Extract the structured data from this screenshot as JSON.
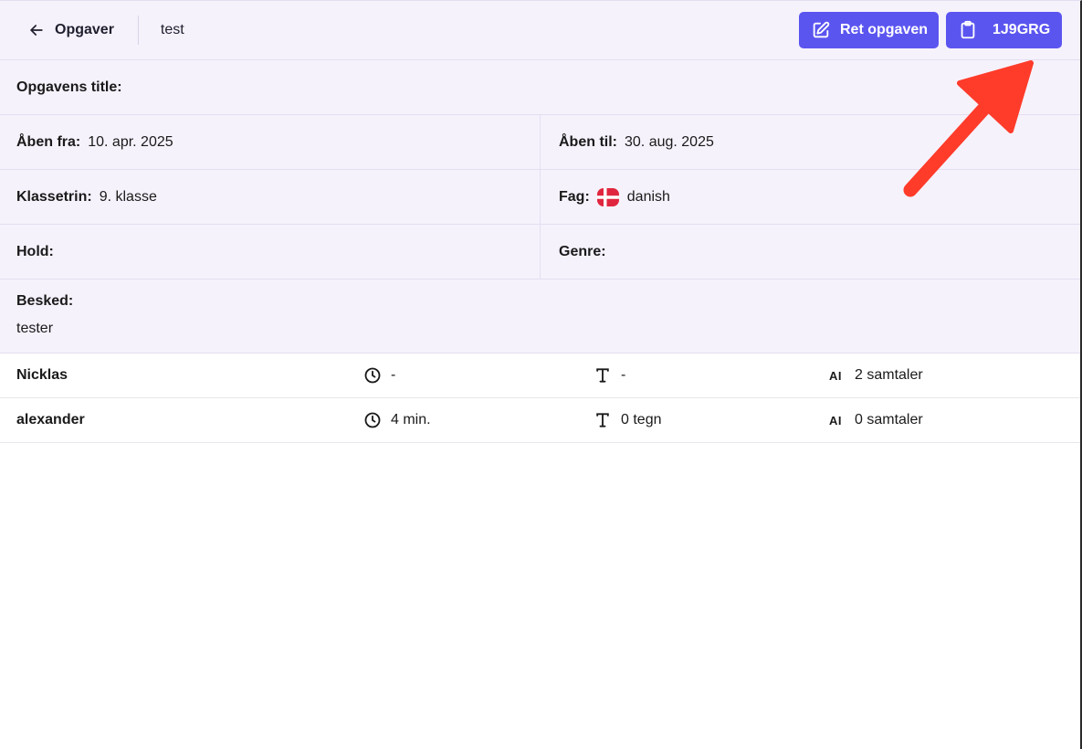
{
  "header": {
    "back_label": "Opgaver",
    "task_name": "test",
    "edit_button_label": "Ret opgaven",
    "code_button_label": "1J9GRG"
  },
  "details": {
    "title_label": "Opgavens title:",
    "title_value": "",
    "open_from_label": "Åben fra:",
    "open_from_value": "10. apr. 2025",
    "open_to_label": "Åben til:",
    "open_to_value": "30. aug. 2025",
    "grade_label": "Klassetrin:",
    "grade_value": "9. klasse",
    "subject_label": "Fag:",
    "subject_value": "danish",
    "team_label": "Hold:",
    "team_value": "",
    "genre_label": "Genre:",
    "genre_value": "",
    "message_label": "Besked:",
    "message_value": "tester"
  },
  "students": [
    {
      "name": "Nicklas",
      "time": "-",
      "chars": "-",
      "ai_badge": "AI",
      "conversations": "2 samtaler"
    },
    {
      "name": "alexander",
      "time": "4 min.",
      "chars": "0 tegn",
      "ai_badge": "AI",
      "conversations": "0 samtaler"
    }
  ],
  "colors": {
    "accent": "#5b55f0",
    "panel_bg": "#f6f2fc",
    "annotation_arrow": "#ff3b2a",
    "flag_red": "#e0263f"
  },
  "icons": {
    "back": "arrow-left-icon",
    "edit": "pencil-square-icon",
    "code": "clipboard-icon",
    "flag": "denmark-flag-icon",
    "time": "clock-icon",
    "chars": "text-icon"
  }
}
